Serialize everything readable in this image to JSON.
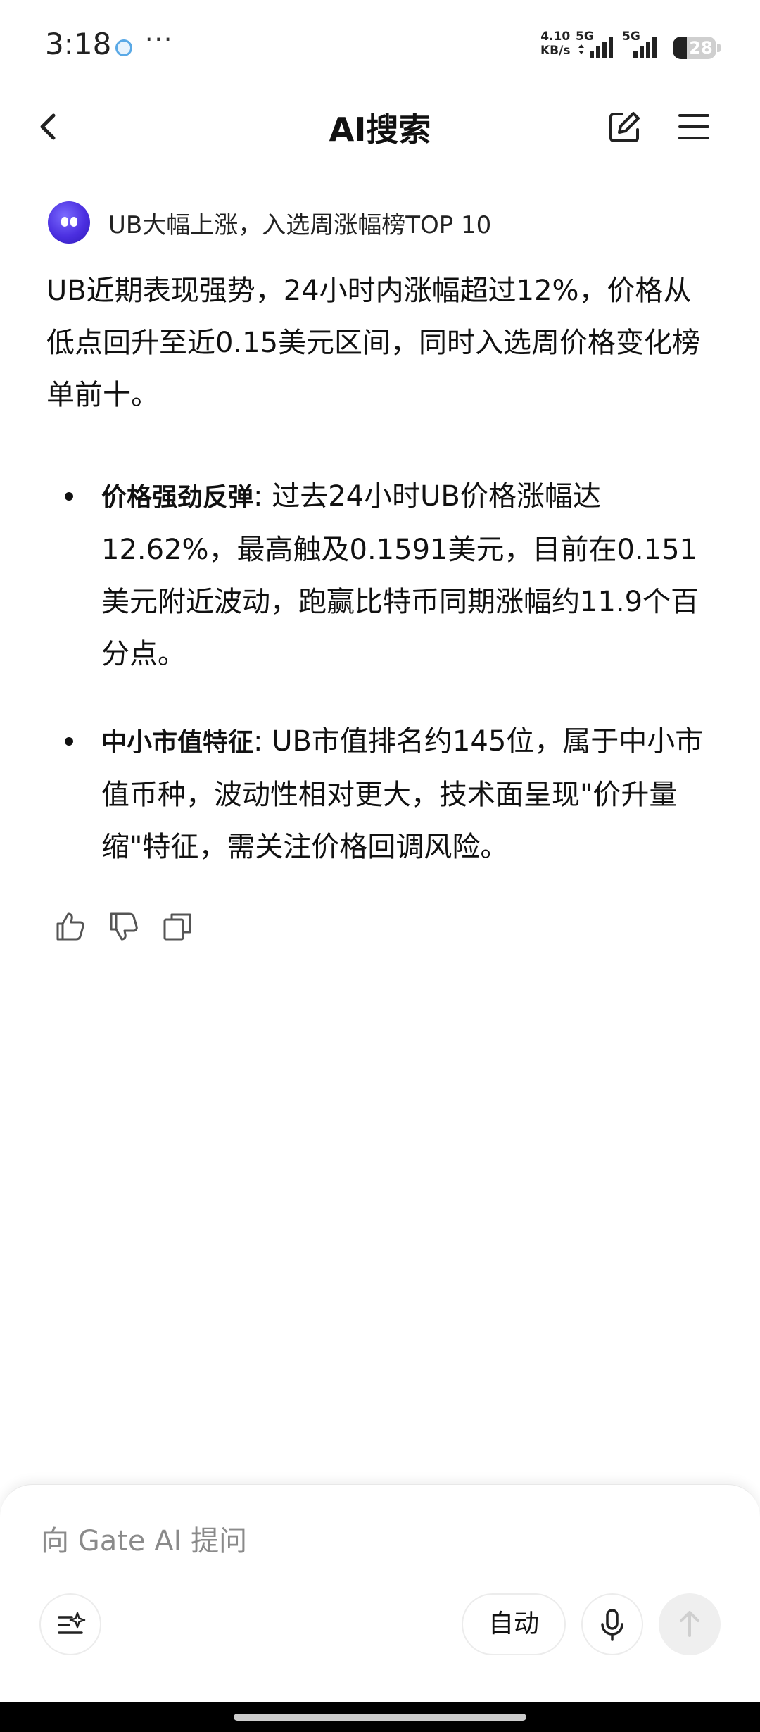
{
  "status_bar": {
    "time": "3:18",
    "more": "···",
    "speed_value": "4.10",
    "speed_unit": "KB/s",
    "network_1": "5G",
    "network_2": "5G",
    "battery_level": "28"
  },
  "header": {
    "title": "AI搜索",
    "icons": {
      "back": "chevron-left-icon",
      "edit": "edit-icon",
      "menu": "menu-icon"
    }
  },
  "topic": {
    "title": "UB大幅上涨，入选周涨幅榜TOP 10",
    "avatar_color": "#4b2fe0"
  },
  "answer": {
    "summary": "UB近期表现强势，24小时内涨幅超过12%，价格从低点回升至近0.15美元区间，同时入选周价格变化榜单前十。",
    "bullets": [
      {
        "title": "价格强劲反弹",
        "text": ": 过去24小时UB价格涨幅达12.62%，最高触及0.1591美元，目前在0.151美元附近波动，跑赢比特币同期涨幅约11.9个百分点。"
      },
      {
        "title": "中小市值特征",
        "text": ": UB市值排名约145位，属于中小市值币种，波动性相对更大，技术面呈现\"价升量缩\"特征，需关注价格回调风险。"
      }
    ],
    "actions": [
      "thumbs-up-icon",
      "thumbs-down-icon",
      "copy-icon"
    ]
  },
  "composer": {
    "placeholder": "向 Gate AI 提问",
    "value": "",
    "mode_label": "自动",
    "icons": {
      "tools": "sparkle-list-icon",
      "voice": "microphone-icon",
      "send": "arrow-up-icon"
    }
  }
}
